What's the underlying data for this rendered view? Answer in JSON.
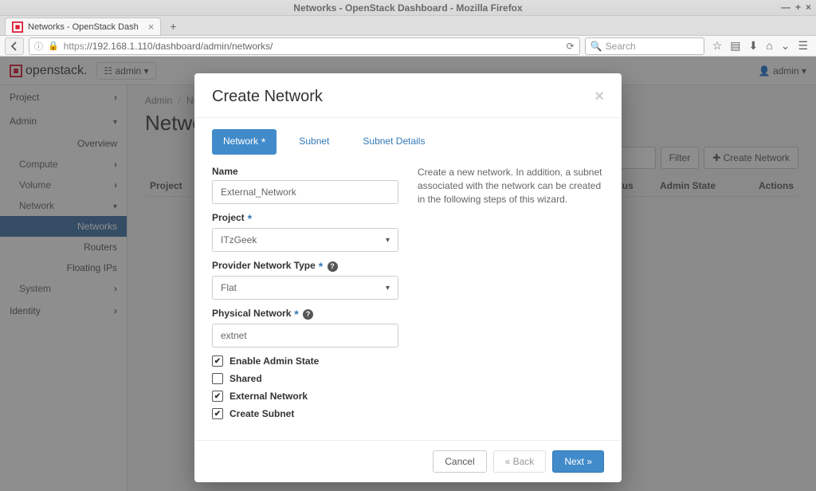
{
  "window": {
    "title": "Networks - OpenStack Dashboard - Mozilla Firefox"
  },
  "tab": {
    "label": "Networks - OpenStack Dash"
  },
  "url": {
    "scheme_badge": "https",
    "path": "://192.168.1.110/dashboard/admin/networks/"
  },
  "search": {
    "placeholder": "Search"
  },
  "brand": {
    "name": "openstack."
  },
  "domain_selector": {
    "icon_label": "",
    "label": "admin"
  },
  "user_menu": {
    "label": "admin"
  },
  "sidebar": {
    "project": "Project",
    "admin": "Admin",
    "overview": "Overview",
    "compute": "Compute",
    "volume": "Volume",
    "network": "Network",
    "networks": "Networks",
    "routers": "Routers",
    "floating_ips": "Floating IPs",
    "system": "System",
    "identity": "Identity"
  },
  "breadcrumb": {
    "a": "Admin",
    "b": "Netwo"
  },
  "page": {
    "heading": "Networ"
  },
  "toolbar": {
    "filter": "Filter",
    "create": "Create Network"
  },
  "table": {
    "cols": {
      "project": "Project",
      "status": "Status",
      "admin_state": "Admin State",
      "actions": "Actions"
    }
  },
  "modal": {
    "title": "Create Network",
    "tabs": {
      "network": "Network",
      "subnet": "Subnet",
      "subnet_details": "Subnet Details"
    },
    "description": "Create a new network. In addition, a subnet associated with the network can be created in the following steps of this wizard.",
    "fields": {
      "name_label": "Name",
      "name_value": "External_Network",
      "project_label": "Project",
      "project_value": "ITzGeek",
      "provider_type_label": "Provider Network Type",
      "provider_type_value": "Flat",
      "physical_label": "Physical Network",
      "physical_value": "extnet"
    },
    "checks": {
      "enable_admin": "Enable Admin State",
      "shared": "Shared",
      "external": "External Network",
      "create_subnet": "Create Subnet"
    },
    "footer": {
      "cancel": "Cancel",
      "back": "« Back",
      "next": "Next »"
    }
  }
}
